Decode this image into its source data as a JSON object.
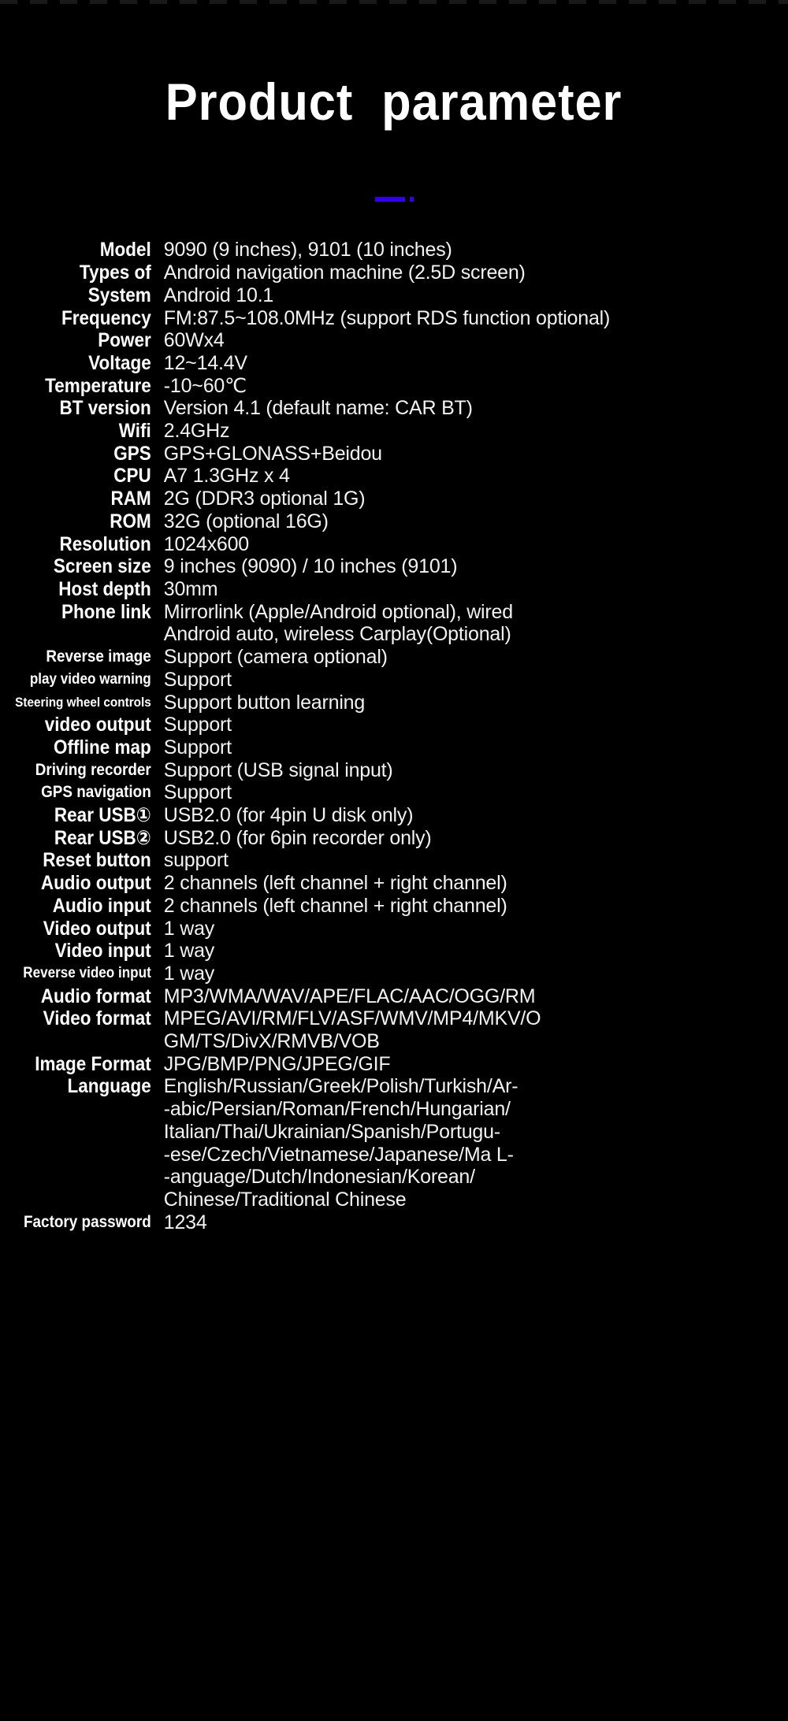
{
  "header": {
    "title": "Product  parameter",
    "accent_color": "#3300ee",
    "background_color": "#000000",
    "text_color": "#ffffff"
  },
  "divider": {
    "bar_label": "",
    "dot_label": ""
  },
  "spec_table": {
    "rows": [
      {
        "label": "Model",
        "value": "9090 (9 inches), 9101 (10 inches)",
        "size": "n"
      },
      {
        "label": "Types of",
        "value": "Android navigation machine (2.5D screen)",
        "size": "n"
      },
      {
        "label": "System",
        "value": "Android 10.1",
        "size": "n"
      },
      {
        "label": "Frequency",
        "value": "FM:87.5~108.0MHz (support RDS function optional)",
        "size": "n"
      },
      {
        "label": "Power",
        "value": "60Wx4",
        "size": "n"
      },
      {
        "label": "Voltage",
        "value": "12~14.4V",
        "size": "n"
      },
      {
        "label": "Temperature",
        "value": "-10~60℃",
        "size": "n"
      },
      {
        "label": "BT version",
        "value": "Version 4.1 (default name: CAR BT)",
        "size": "n"
      },
      {
        "label": "Wifi",
        "value": "2.4GHz",
        "size": "n"
      },
      {
        "label": "GPS",
        "value": "GPS+GLONASS+Beidou",
        "size": "n"
      },
      {
        "label": "CPU",
        "value": "A7 1.3GHz x 4",
        "size": "n"
      },
      {
        "label": "RAM",
        "value": "2G (DDR3 optional 1G)",
        "size": "n"
      },
      {
        "label": "ROM",
        "value": "32G (optional 16G)",
        "size": "n"
      },
      {
        "label": "Resolution",
        "value": "1024x600",
        "size": "n"
      },
      {
        "label": "Screen size",
        "value": "9 inches (9090) / 10 inches (9101)",
        "size": "n"
      },
      {
        "label": "Host depth",
        "value": "30mm",
        "size": "n"
      },
      {
        "label": "Phone link",
        "value": "Mirrorlink (Apple/Android optional), wired\nAndroid auto, wireless Carplay(Optional)",
        "size": "n"
      },
      {
        "label": "Reverse image",
        "value": "Support (camera optional)",
        "size": "s"
      },
      {
        "label": "play video warning",
        "value": "Support",
        "size": "xxs"
      },
      {
        "label": "Steering wheel controls",
        "value": "Support button learning",
        "size": "xs"
      },
      {
        "label": "video output",
        "value": "Support",
        "size": "n"
      },
      {
        "label": "Offline map",
        "value": "Support",
        "size": "n"
      },
      {
        "label": "Driving recorder",
        "value": "Support (USB signal input)",
        "size": "s"
      },
      {
        "label": "GPS navigation",
        "value": "Support",
        "size": "s"
      },
      {
        "label": "Rear USB①",
        "value": "USB2.0 (for 4pin U disk only)",
        "size": "n"
      },
      {
        "label": "Rear USB②",
        "value": "USB2.0 (for 6pin recorder only)",
        "size": "n"
      },
      {
        "label": "Reset button",
        "value": "support",
        "size": "n"
      },
      {
        "label": "Audio output",
        "value": "2 channels (left channel + right channel)",
        "size": "n"
      },
      {
        "label": "Audio input",
        "value": "2 channels (left channel + right channel)",
        "size": "n"
      },
      {
        "label": "Video output",
        "value": "1 way",
        "size": "n"
      },
      {
        "label": "Video input",
        "value": "1 way",
        "size": "n"
      },
      {
        "label": "Reverse video input",
        "value": "1 way",
        "size": "xxs"
      },
      {
        "label": "Audio format",
        "value": "MP3/WMA/WAV/APE/FLAC/AAC/OGG/RM",
        "size": "n"
      },
      {
        "label": "Video format",
        "value": "MPEG/AVI/RM/FLV/ASF/WMV/MP4/MKV/O\nGM/TS/DivX/RMVB/VOB",
        "size": "n"
      },
      {
        "label": "Image Format",
        "value": "JPG/BMP/PNG/JPEG/GIF",
        "size": "n"
      },
      {
        "label": "Language",
        "value": "English/Russian/Greek/Polish/Turkish/Ar-\n-abic/Persian/Roman/French/Hungarian/\nItalian/Thai/Ukrainian/Spanish/Portugu-\n-ese/Czech/Vietnamese/Japanese/Ma L-\n-anguage/Dutch/Indonesian/Korean/\nChinese/Traditional Chinese",
        "size": "n"
      },
      {
        "label": "Factory password",
        "value": "1234",
        "size": "s"
      }
    ]
  }
}
